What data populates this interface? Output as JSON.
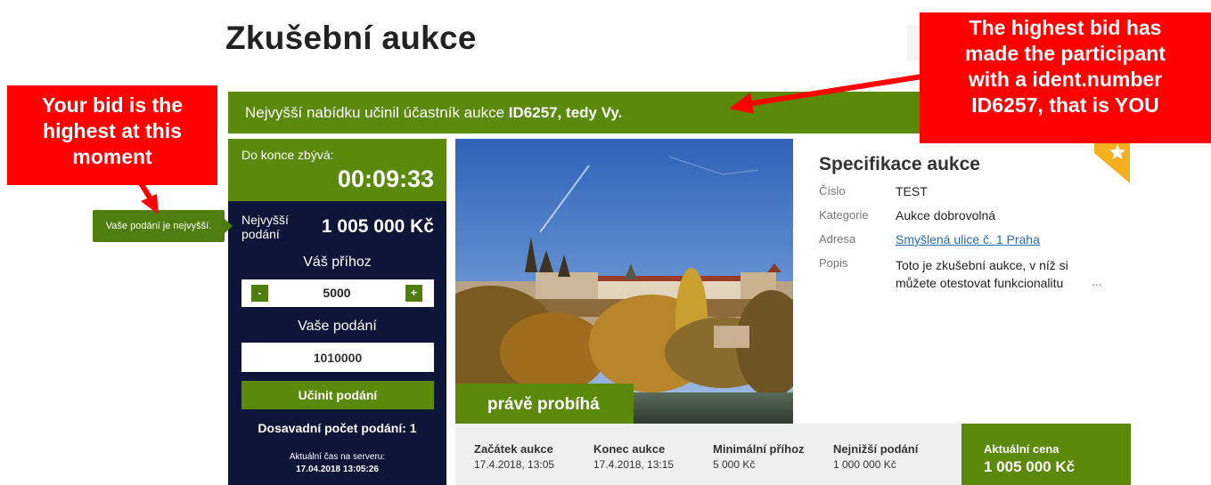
{
  "page": {
    "title": "Zkušební aukce"
  },
  "status_bar": {
    "prefix": "Nejvyšší nabídku učinil účastník aukce",
    "bidder": "ID6257, tedy Vy."
  },
  "countdown": {
    "label": "Do konce zbývá:",
    "value": "00:09:33"
  },
  "highest_bid": {
    "label": "Nejvyšší podání",
    "value": "1 005 000 Kč"
  },
  "increment": {
    "label": "Váš příhoz",
    "minus": "-",
    "plus": "+",
    "value": "5000"
  },
  "your_bid": {
    "label": "Vaše podání",
    "value": "1010000"
  },
  "submit": {
    "label": "Učinit podání"
  },
  "bid_count": {
    "label": "Dosavadní počet podání:",
    "value": "1"
  },
  "server_time": {
    "label": "Aktuální čas na serveru:",
    "value": "17.04.2018 13:05:26"
  },
  "photo": {
    "status": "právě probíhá"
  },
  "spec": {
    "title": "Specifikace aukce",
    "rows": [
      {
        "key": "Číslo",
        "value": "TEST"
      },
      {
        "key": "Kategorie",
        "value": "Aukce dobrovolná"
      },
      {
        "key": "Adresa",
        "value": "Smyšlená ulice č. 1 Praha"
      },
      {
        "key": "Popis",
        "value": "Toto je zkušební aukce, v níž si můžete otestovat funkcionalitu"
      }
    ],
    "more": "..."
  },
  "info": [
    {
      "label": "Začátek aukce",
      "value": "17.4.2018, 13:05"
    },
    {
      "label": "Konec aukce",
      "value": "17.4.2018, 13:15"
    },
    {
      "label": "Minimální příhoz",
      "value": "5 000 Kč"
    },
    {
      "label": "Nejnižší podání",
      "value": "1 000 000 Kč"
    }
  ],
  "current_price": {
    "label": "Aktuální cena",
    "value": "1 005 000 Kč"
  },
  "tooltip": {
    "text": "Vaše podání je nejvyšší."
  },
  "callouts": {
    "left": [
      "Your bid is the",
      "highest at this",
      "moment"
    ],
    "right": [
      "The highest bid has",
      "made the participant",
      "with a ident.number",
      "ID6257, that is YOU"
    ]
  },
  "colors": {
    "green": "#5b8a0b",
    "navy": "#0d1538",
    "callout_red": "#ff0000",
    "ribbon": "#f2b01e",
    "link": "#2a6cb3"
  },
  "icons": {
    "ribbon": "star-icon",
    "arrows": "callout-arrow-icon"
  }
}
